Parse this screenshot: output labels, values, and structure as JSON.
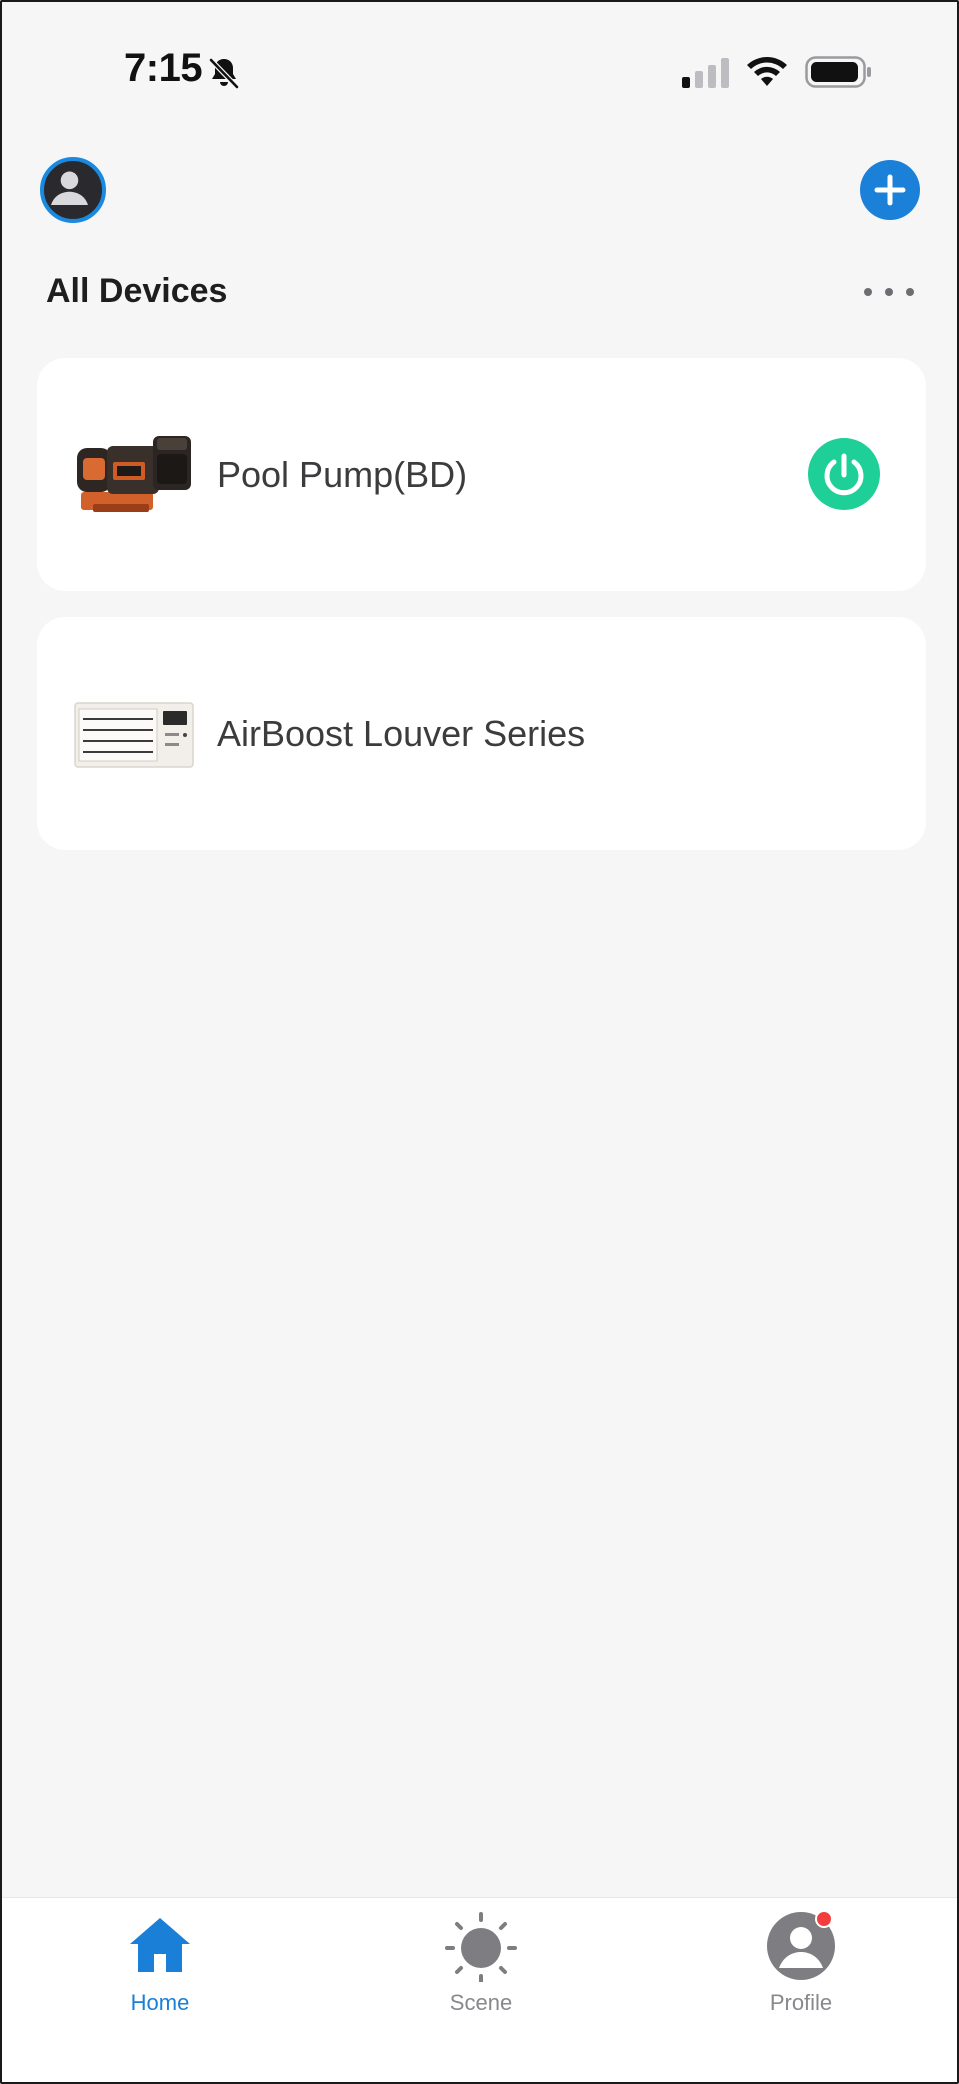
{
  "status_bar": {
    "time": "7:15",
    "icons": [
      "bell-slash-icon",
      "cellular-signal-icon",
      "wifi-icon",
      "battery-icon"
    ]
  },
  "header": {
    "avatar_icon": "user-avatar-icon",
    "add_icon": "plus-icon",
    "title": "All Devices",
    "more_icon": "more-horizontal-icon"
  },
  "devices": [
    {
      "name": "Pool Pump(BD)",
      "thumbnail": "pool-pump-thumbnail",
      "has_power_button": true,
      "power_color": "#1fcf98"
    },
    {
      "name": "AirBoost Louver Series",
      "thumbnail": "louver-thumbnail",
      "has_power_button": false
    }
  ],
  "tabbar": {
    "tabs": [
      {
        "label": "Home",
        "icon": "home-icon",
        "active": true
      },
      {
        "label": "Scene",
        "icon": "sun-icon",
        "active": false
      },
      {
        "label": "Profile",
        "icon": "profile-icon",
        "active": false,
        "badge": true
      }
    ]
  },
  "colors": {
    "accent": "#1a7fd6",
    "power_on": "#1fcf98",
    "badge": "#f43d3d",
    "background": "#f6f6f7"
  }
}
